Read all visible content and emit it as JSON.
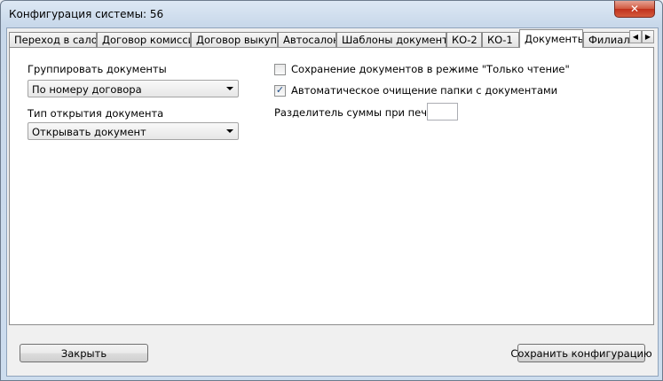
{
  "window": {
    "title": "Конфигурация системы: 56",
    "close_glyph": "✕"
  },
  "tabs": [
    {
      "label": "Переход в салон"
    },
    {
      "label": "Договор комиссии"
    },
    {
      "label": "Договор выкупа"
    },
    {
      "label": "Автосалон"
    },
    {
      "label": "Шаблоны документов"
    },
    {
      "label": "КО-2"
    },
    {
      "label": "КО-1"
    },
    {
      "label": "Документы",
      "active": true
    },
    {
      "label": "Филиалы"
    }
  ],
  "tab_scroll": {
    "left": "◀",
    "right": "▶"
  },
  "documents": {
    "group_label": "Группировать документы",
    "group_value": "По номеру договора",
    "open_type_label": "Тип открытия документа",
    "open_type_value": "Открывать документ",
    "readonly_label": "Сохранение документов в режиме \"Только чтение\"",
    "readonly_checked": false,
    "autoclean_label": "Автоматическое очищение папки с документами",
    "autoclean_checked": true,
    "check_glyph": "✓",
    "separator_label": "Разделитель суммы при печати",
    "separator_value": ""
  },
  "buttons": {
    "close": "Закрыть",
    "save": "Сохранить конфигурацию"
  }
}
